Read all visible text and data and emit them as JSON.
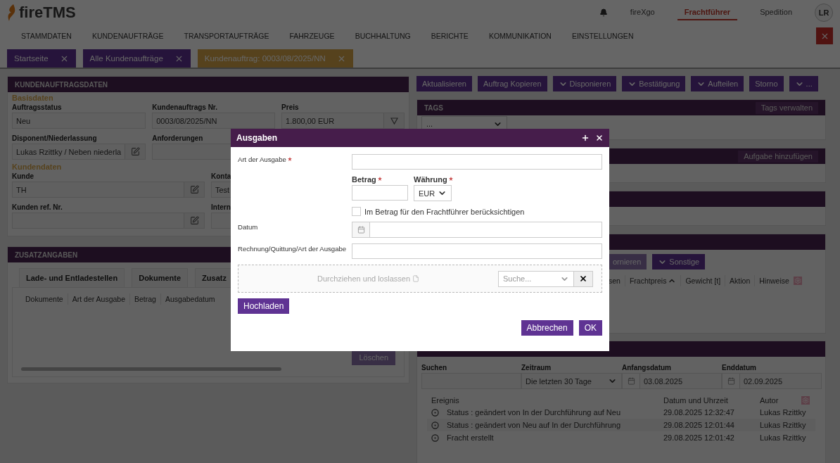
{
  "header": {
    "logo": "fireTMS",
    "links": [
      {
        "label": "fireXgo",
        "selected": false
      },
      {
        "label": "Frachtführer",
        "selected": true
      },
      {
        "label": "Spedition",
        "selected": false
      }
    ],
    "avatar": "LR"
  },
  "menu": [
    "STAMMDATEN",
    "KUNDENAUFTRÄGE",
    "TRANSPORTAUFTRÄGE",
    "FAHRZEUGE",
    "BUCHHALTUNG",
    "BERICHTE",
    "KOMMUNIKATION",
    "EINSTELLUNGEN"
  ],
  "tabs": [
    {
      "label": "Startseite",
      "selected": false
    },
    {
      "label": "Alle Kundenaufträge",
      "selected": false
    },
    {
      "label": "Kundenauftrag: 0003/08/2025/NN",
      "selected": true
    }
  ],
  "order_panel": {
    "title": "KUNDENAUFTRAGSDATEN",
    "sections": [
      {
        "title": "Basisdaten",
        "fields": [
          {
            "label": "Auftragsstatus",
            "value": "Neu",
            "kind": "text"
          },
          {
            "label": "Kundenauftrags Nr.",
            "value": "0003/08/2025/NN",
            "kind": "text"
          },
          {
            "label": "Preis",
            "value": "1.800,00 EUR",
            "kind": "filter"
          },
          {
            "label": "Disponent/Niederlassung",
            "value": "Lukas Rzittky / Neben niederla",
            "kind": "edit"
          },
          {
            "label": "Anforderungen",
            "kind": "text"
          }
        ]
      },
      {
        "title": "Kundendaten",
        "fields": [
          {
            "label": "Kunde",
            "value": "TH",
            "kind": "edit"
          },
          {
            "label": "Konta",
            "value": "Test",
            "kind": "text"
          },
          {
            "label": "Kunden ref. Nr.",
            "kind": "edit"
          },
          {
            "label": "Intern",
            "kind": "text"
          }
        ]
      }
    ]
  },
  "extra_panel": {
    "title": "ZUSATZANGABEN",
    "tabs": [
      "Lade- und Entladestellen",
      "Dokumente",
      "Zusatz"
    ],
    "columns": [
      "Dokumente",
      "Art der Ausgabe",
      "Betrag",
      "Ausgabedatum"
    ],
    "delete_button": "Löschen"
  },
  "actions": [
    {
      "label": "Aktualisieren",
      "dropdown": false
    },
    {
      "label": "Auftrag Kopieren",
      "dropdown": false
    },
    {
      "label": "Disponieren",
      "dropdown": true
    },
    {
      "label": "Bestätigung",
      "dropdown": true
    },
    {
      "label": "Aufteilen",
      "dropdown": true
    },
    {
      "label": "Storno",
      "dropdown": false
    },
    {
      "label": "...",
      "dropdown": true
    }
  ],
  "tags_panel": {
    "title": "TAGS",
    "action": "Tags verwalten",
    "select": "..."
  },
  "tasks_panel": {
    "action": "Aufgabe hinzufügen"
  },
  "transport_panel": {
    "buttons": [
      {
        "label": "ornieren",
        "disabled": true,
        "dropdown": false
      },
      {
        "label": "Sonstige",
        "disabled": false,
        "dropdown": true
      }
    ],
    "columns": [
      {
        "label": "sen",
        "sorted": false
      },
      {
        "label": "Frachtpreis",
        "sorted": true
      },
      {
        "label": "Gewicht [t]",
        "sorted": false
      },
      {
        "label": "Aktion",
        "sorted": false
      },
      {
        "label": "Hinweise",
        "sorted": false
      }
    ]
  },
  "history_panel": {
    "filters": [
      {
        "label": "Suchen",
        "kind": "text"
      },
      {
        "label": "Zeitraum",
        "kind": "select",
        "value": "Die letzten 30 Tage"
      },
      {
        "label": "Anfangsdatum",
        "kind": "date",
        "value": "03.08.2025"
      },
      {
        "label": "Enddatum",
        "kind": "date",
        "value": "02.09.2025"
      }
    ],
    "columns": [
      "Ereignis",
      "Datum und Uhrzeit",
      "Autor"
    ],
    "rows": [
      {
        "event": "Status : geändert von In der Durchführung auf Neu",
        "time": "29.08.2025 12:32:47",
        "author": "Lukas Rzittky"
      },
      {
        "event": "Status : geändert von Neu auf In der Durchführung",
        "time": "29.08.2025 12:01:44",
        "author": "Lukas Rzittky"
      },
      {
        "event": "Fracht erstellt",
        "time": "29.08.2025 12:01:42",
        "author": "Lukas Rzittky"
      }
    ]
  },
  "modal": {
    "title": "Ausgaben",
    "expense_type": {
      "label": "Art der Ausgabe",
      "required": true
    },
    "amount": {
      "label": "Betrag",
      "required": true
    },
    "currency": {
      "label": "Währung",
      "required": true,
      "value": "EUR"
    },
    "include_checkbox": {
      "label": "Im Betrag für den Frachtführer berücksichtigen",
      "checked": false
    },
    "date": {
      "label": "Datum"
    },
    "receipt": {
      "label": "Rechnung/Quittung/Art der Ausgabe"
    },
    "dropzone": {
      "text": "Durchziehen und loslassen",
      "search_placeholder": "Suche..."
    },
    "upload_button": "Hochladen",
    "buttons": [
      "Abbrechen",
      "OK"
    ]
  }
}
